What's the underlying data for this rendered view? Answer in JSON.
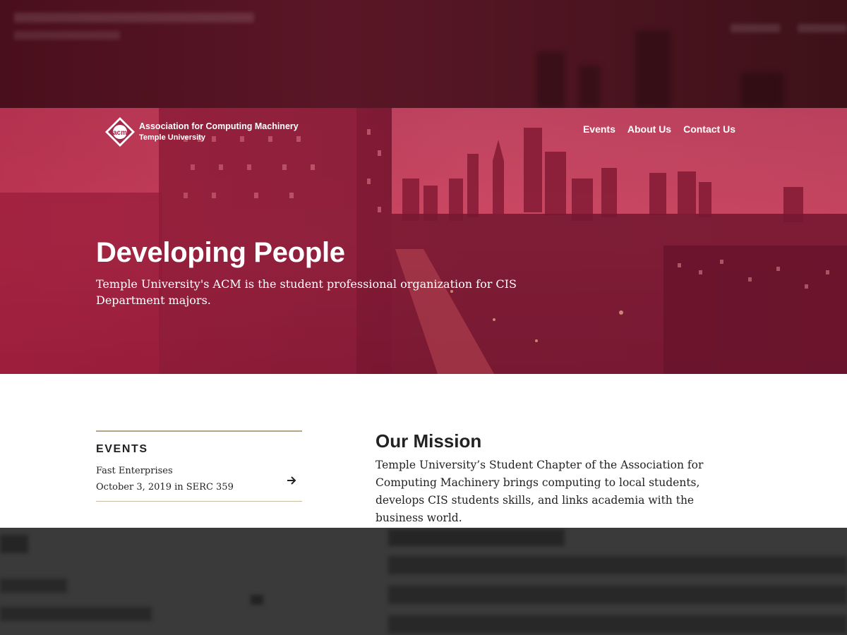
{
  "brand": {
    "org_name": "Association for Computing Machinery",
    "university": "Temple University",
    "logo_text": "acm"
  },
  "nav": {
    "items": [
      "Events",
      "About Us",
      "Contact Us"
    ]
  },
  "hero": {
    "title": "Developing People",
    "subtitle": "Temple University's ACM is the student professional organization for CIS Department majors."
  },
  "events": {
    "heading": "EVENTS",
    "items": [
      {
        "name": "Fast Enterprises",
        "date": "October 3, 2019 in SERC 359"
      }
    ]
  },
  "mission": {
    "heading": "Our Mission",
    "text": "Temple University’s Student Chapter of the Association for Computing Machinery brings computing to local students, develops CIS students skills, and links academia with the business world."
  },
  "colors": {
    "hero_red": "#a2294a",
    "accent_gold": "#b9a584",
    "text_dark": "#222222"
  }
}
